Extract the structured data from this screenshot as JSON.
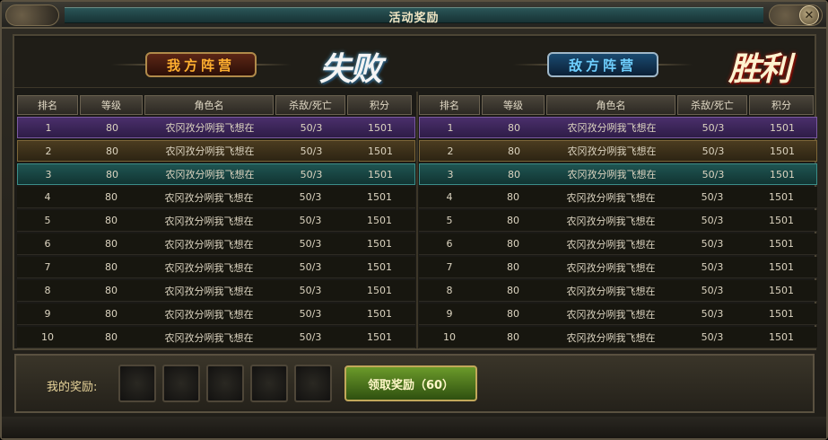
{
  "window": {
    "title": "活动奖励"
  },
  "camps": {
    "ours": {
      "label": "我方阵营",
      "result": "失败"
    },
    "enemy": {
      "label": "敌方阵营",
      "result": "胜利"
    }
  },
  "columns": [
    "排名",
    "等级",
    "角色名",
    "杀敌/死亡",
    "积分"
  ],
  "left_rows": [
    [
      "1",
      "80",
      "农冈孜分咧我飞想在",
      "50/3",
      "1501"
    ],
    [
      "2",
      "80",
      "农冈孜分咧我飞想在",
      "50/3",
      "1501"
    ],
    [
      "3",
      "80",
      "农冈孜分咧我飞想在",
      "50/3",
      "1501"
    ],
    [
      "4",
      "80",
      "农冈孜分咧我飞想在",
      "50/3",
      "1501"
    ],
    [
      "5",
      "80",
      "农冈孜分咧我飞想在",
      "50/3",
      "1501"
    ],
    [
      "6",
      "80",
      "农冈孜分咧我飞想在",
      "50/3",
      "1501"
    ],
    [
      "7",
      "80",
      "农冈孜分咧我飞想在",
      "50/3",
      "1501"
    ],
    [
      "8",
      "80",
      "农冈孜分咧我飞想在",
      "50/3",
      "1501"
    ],
    [
      "9",
      "80",
      "农冈孜分咧我飞想在",
      "50/3",
      "1501"
    ],
    [
      "10",
      "80",
      "农冈孜分咧我飞想在",
      "50/3",
      "1501"
    ]
  ],
  "right_rows": [
    [
      "1",
      "80",
      "农冈孜分咧我飞想在",
      "50/3",
      "1501"
    ],
    [
      "2",
      "80",
      "农冈孜分咧我飞想在",
      "50/3",
      "1501"
    ],
    [
      "3",
      "80",
      "农冈孜分咧我飞想在",
      "50/3",
      "1501"
    ],
    [
      "4",
      "80",
      "农冈孜分咧我飞想在",
      "50/3",
      "1501"
    ],
    [
      "5",
      "80",
      "农冈孜分咧我飞想在",
      "50/3",
      "1501"
    ],
    [
      "6",
      "80",
      "农冈孜分咧我飞想在",
      "50/3",
      "1501"
    ],
    [
      "7",
      "80",
      "农冈孜分咧我飞想在",
      "50/3",
      "1501"
    ],
    [
      "8",
      "80",
      "农冈孜分咧我飞想在",
      "50/3",
      "1501"
    ],
    [
      "9",
      "80",
      "农冈孜分咧我飞想在",
      "50/3",
      "1501"
    ],
    [
      "10",
      "80",
      "农冈孜分咧我飞想在",
      "50/3",
      "1501"
    ]
  ],
  "footer": {
    "reward_label": "我的奖励:",
    "claim_button": "领取奖励（60）",
    "slot_count": 5
  }
}
